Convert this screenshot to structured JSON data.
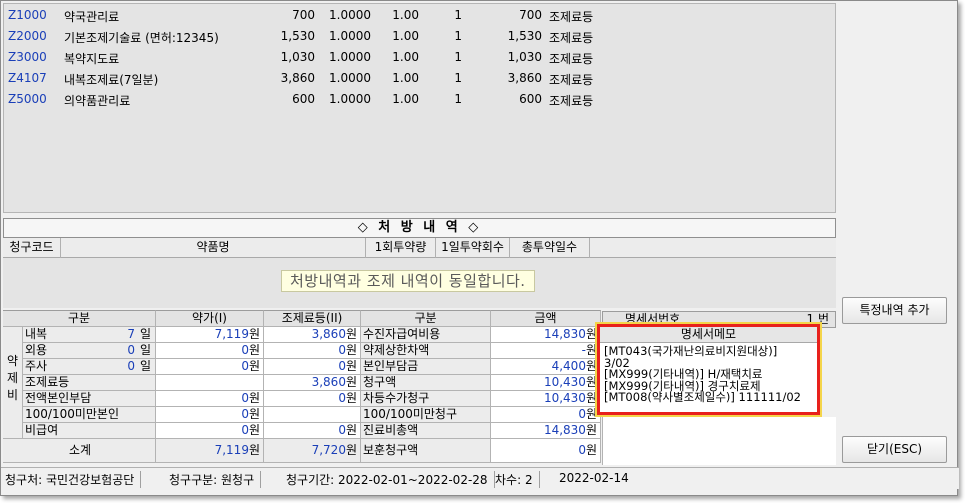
{
  "items": [
    {
      "code": "Z1000",
      "name": "약국관리료",
      "amount": "700",
      "f1": "1.0000",
      "f2": "1.00",
      "f3": "1",
      "total": "700",
      "type": "조제료등"
    },
    {
      "code": "Z2000",
      "name": "기본조제기술료 (면허:12345)",
      "amount": "1,530",
      "f1": "1.0000",
      "f2": "1.00",
      "f3": "1",
      "total": "1,530",
      "type": "조제료등"
    },
    {
      "code": "Z3000",
      "name": "복약지도료",
      "amount": "1,030",
      "f1": "1.0000",
      "f2": "1.00",
      "f3": "1",
      "total": "1,030",
      "type": "조제료등"
    },
    {
      "code": "Z4107",
      "name": "내복조제료(7일분)",
      "amount": "3,860",
      "f1": "1.0000",
      "f2": "1.00",
      "f3": "1",
      "total": "3,860",
      "type": "조제료등"
    },
    {
      "code": "Z5000",
      "name": "의약품관리료",
      "amount": "600",
      "f1": "1.0000",
      "f2": "1.00",
      "f3": "1",
      "total": "600",
      "type": "조제료등"
    }
  ],
  "prescription": {
    "title": "◇ 처 방 내 역 ◇",
    "columns": [
      "청구코드",
      "약품명",
      "1회투약량",
      "1일투약회수",
      "총투약일수"
    ],
    "message": "처방내역과 조제 내역이 동일합니다."
  },
  "summary": {
    "headers": {
      "category": "구분",
      "drug": "약가(I)",
      "dispense": "조제료등(II)",
      "category2": "구분",
      "amount": "금액"
    },
    "side_label": [
      "약",
      "제",
      "비"
    ],
    "unit_won": "원",
    "unit_day": "일",
    "rows": [
      {
        "label": "내복",
        "days": "7",
        "drug": "7,119",
        "dispense": "3,860",
        "label2": "수진자급여비용",
        "amount": "14,830"
      },
      {
        "label": "외용",
        "days": "0",
        "drug": "0",
        "dispense": "0",
        "label2": "약제상한차액",
        "amount": "-"
      },
      {
        "label": "주사",
        "days": "0",
        "drug": "0",
        "dispense": "0",
        "label2": "본인부담금",
        "amount": "4,400"
      },
      {
        "label": "조제료등",
        "days": "",
        "drug": "",
        "dispense": "3,860",
        "label2": "청구액",
        "amount": "10,430"
      },
      {
        "label": "전액본인부담",
        "days": "",
        "drug": "0",
        "dispense": "0",
        "label2": "차등수가청구",
        "amount": "10,430"
      },
      {
        "label": "100/100미만본인",
        "days": "",
        "drug": "0",
        "dispense": "",
        "label2": "100/100미만청구",
        "amount": "0"
      },
      {
        "label": "비급여",
        "days": "",
        "drug": "0",
        "dispense": "0",
        "label2": "진료비총액",
        "amount": "14,830"
      }
    ],
    "subtotal": {
      "label": "소계",
      "drug": "7,119",
      "dispense": "7,720",
      "label2": "보훈청구액",
      "amount": "0"
    }
  },
  "statement": {
    "number_label": "명세서번호",
    "number_value": "1 번",
    "memo_title": "명세서메모",
    "memo_lines": [
      "[MT043(국가재난의료비지원대상)]",
      "3/02",
      "[MX999(기타내역)] H/재택치료",
      "[MX999(기타내역)] 경구치료제",
      "[MT008(약사별조제일수)] 111111/02"
    ]
  },
  "buttons": {
    "add_special": "특정내역 추가",
    "close": "닫기(ESC)"
  },
  "status_bar": {
    "payer": "청구처: 국민건강보험공단",
    "claim_type": "청구구분: 원청구",
    "period": "청구기간: 2022-02-01~2022-02-28",
    "round": "차수: 2",
    "date": "2022-02-14"
  }
}
